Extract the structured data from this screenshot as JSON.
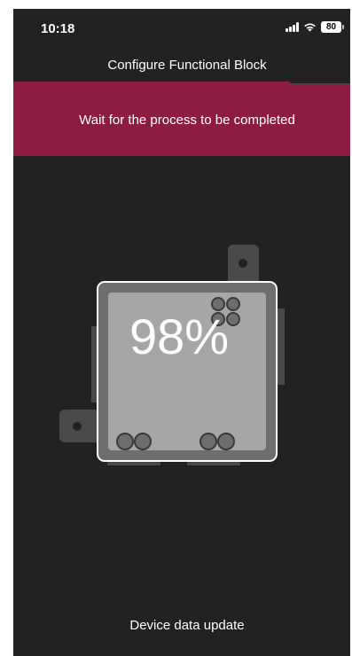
{
  "status_bar": {
    "time": "10:18",
    "battery": "80",
    "icons": [
      "signal-icon",
      "wifi-icon",
      "battery-icon"
    ]
  },
  "header": {
    "title": "Configure Functional Block"
  },
  "banner": {
    "message": "Wait for the process to be completed"
  },
  "progress": {
    "label": "98%",
    "value_percent": 98
  },
  "footer": {
    "status": "Device data update"
  },
  "colors": {
    "background": "#222222",
    "accent": "#8e1c40",
    "device_body": "#a6a6a6",
    "device_frame": "#6e6e6e",
    "device_border": "#ffffff"
  }
}
